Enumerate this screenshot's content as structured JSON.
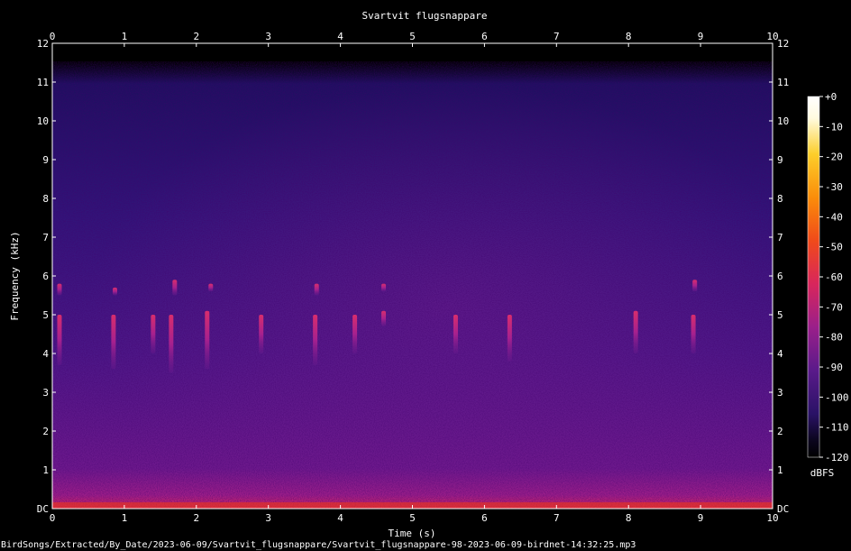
{
  "chart_data": {
    "type": "heatmap",
    "title": "Svartvit flugsnappare",
    "xlabel": "Time (s)",
    "ylabel": "Frequency (kHz)",
    "xlim": [
      0,
      10
    ],
    "ylim": [
      0,
      12
    ],
    "x_ticks": [
      "0",
      "1",
      "2",
      "3",
      "4",
      "5",
      "6",
      "7",
      "8",
      "9",
      "10"
    ],
    "y_ticks": [
      "DC",
      "1",
      "2",
      "3",
      "4",
      "5",
      "6",
      "7",
      "8",
      "9",
      "10",
      "11",
      "12"
    ],
    "colorbar": {
      "label": "dBFS",
      "range": [
        -120,
        0
      ],
      "ticks": [
        "+0",
        "-10",
        "-20",
        "-30",
        "-40",
        "-50",
        "-60",
        "-70",
        "-80",
        "-90",
        "-100",
        "-110",
        "-120"
      ],
      "colormap": [
        "#000000",
        "#0c0620",
        "#2a1266",
        "#5a1a8a",
        "#9a1f8a",
        "#d8265c",
        "#f04a1a",
        "#fb8d0a",
        "#fcce2a",
        "#fffbe0",
        "#ffffff"
      ]
    },
    "calls": [
      {
        "time": 0.1,
        "freq_low": 3.7,
        "freq_high": 5.0
      },
      {
        "time": 0.1,
        "freq_low": 5.5,
        "freq_high": 5.8
      },
      {
        "time": 0.85,
        "freq_low": 3.6,
        "freq_high": 5.0
      },
      {
        "time": 0.87,
        "freq_low": 5.5,
        "freq_high": 5.7
      },
      {
        "time": 1.4,
        "freq_low": 4.0,
        "freq_high": 5.0
      },
      {
        "time": 1.65,
        "freq_low": 3.5,
        "freq_high": 5.0
      },
      {
        "time": 1.7,
        "freq_low": 5.5,
        "freq_high": 5.9
      },
      {
        "time": 2.15,
        "freq_low": 3.6,
        "freq_high": 5.1
      },
      {
        "time": 2.2,
        "freq_low": 5.6,
        "freq_high": 5.8
      },
      {
        "time": 2.9,
        "freq_low": 4.0,
        "freq_high": 5.0
      },
      {
        "time": 3.65,
        "freq_low": 3.7,
        "freq_high": 5.0
      },
      {
        "time": 3.67,
        "freq_low": 5.5,
        "freq_high": 5.8
      },
      {
        "time": 4.2,
        "freq_low": 4.0,
        "freq_high": 5.0
      },
      {
        "time": 4.6,
        "freq_low": 4.7,
        "freq_high": 5.1
      },
      {
        "time": 4.6,
        "freq_low": 5.6,
        "freq_high": 5.8
      },
      {
        "time": 5.6,
        "freq_low": 4.0,
        "freq_high": 5.0
      },
      {
        "time": 6.35,
        "freq_low": 3.8,
        "freq_high": 5.0
      },
      {
        "time": 8.1,
        "freq_low": 4.0,
        "freq_high": 5.1
      },
      {
        "time": 8.9,
        "freq_low": 4.0,
        "freq_high": 5.0
      },
      {
        "time": 8.92,
        "freq_low": 5.6,
        "freq_high": 5.9
      }
    ]
  },
  "footer": {
    "source_path": "BirdSongs/Extracted/By_Date/2023-06-09/Svartvit_flugsnappare/Svartvit_flugsnappare-98-2023-06-09-birdnet-14:32:25.mp3"
  }
}
